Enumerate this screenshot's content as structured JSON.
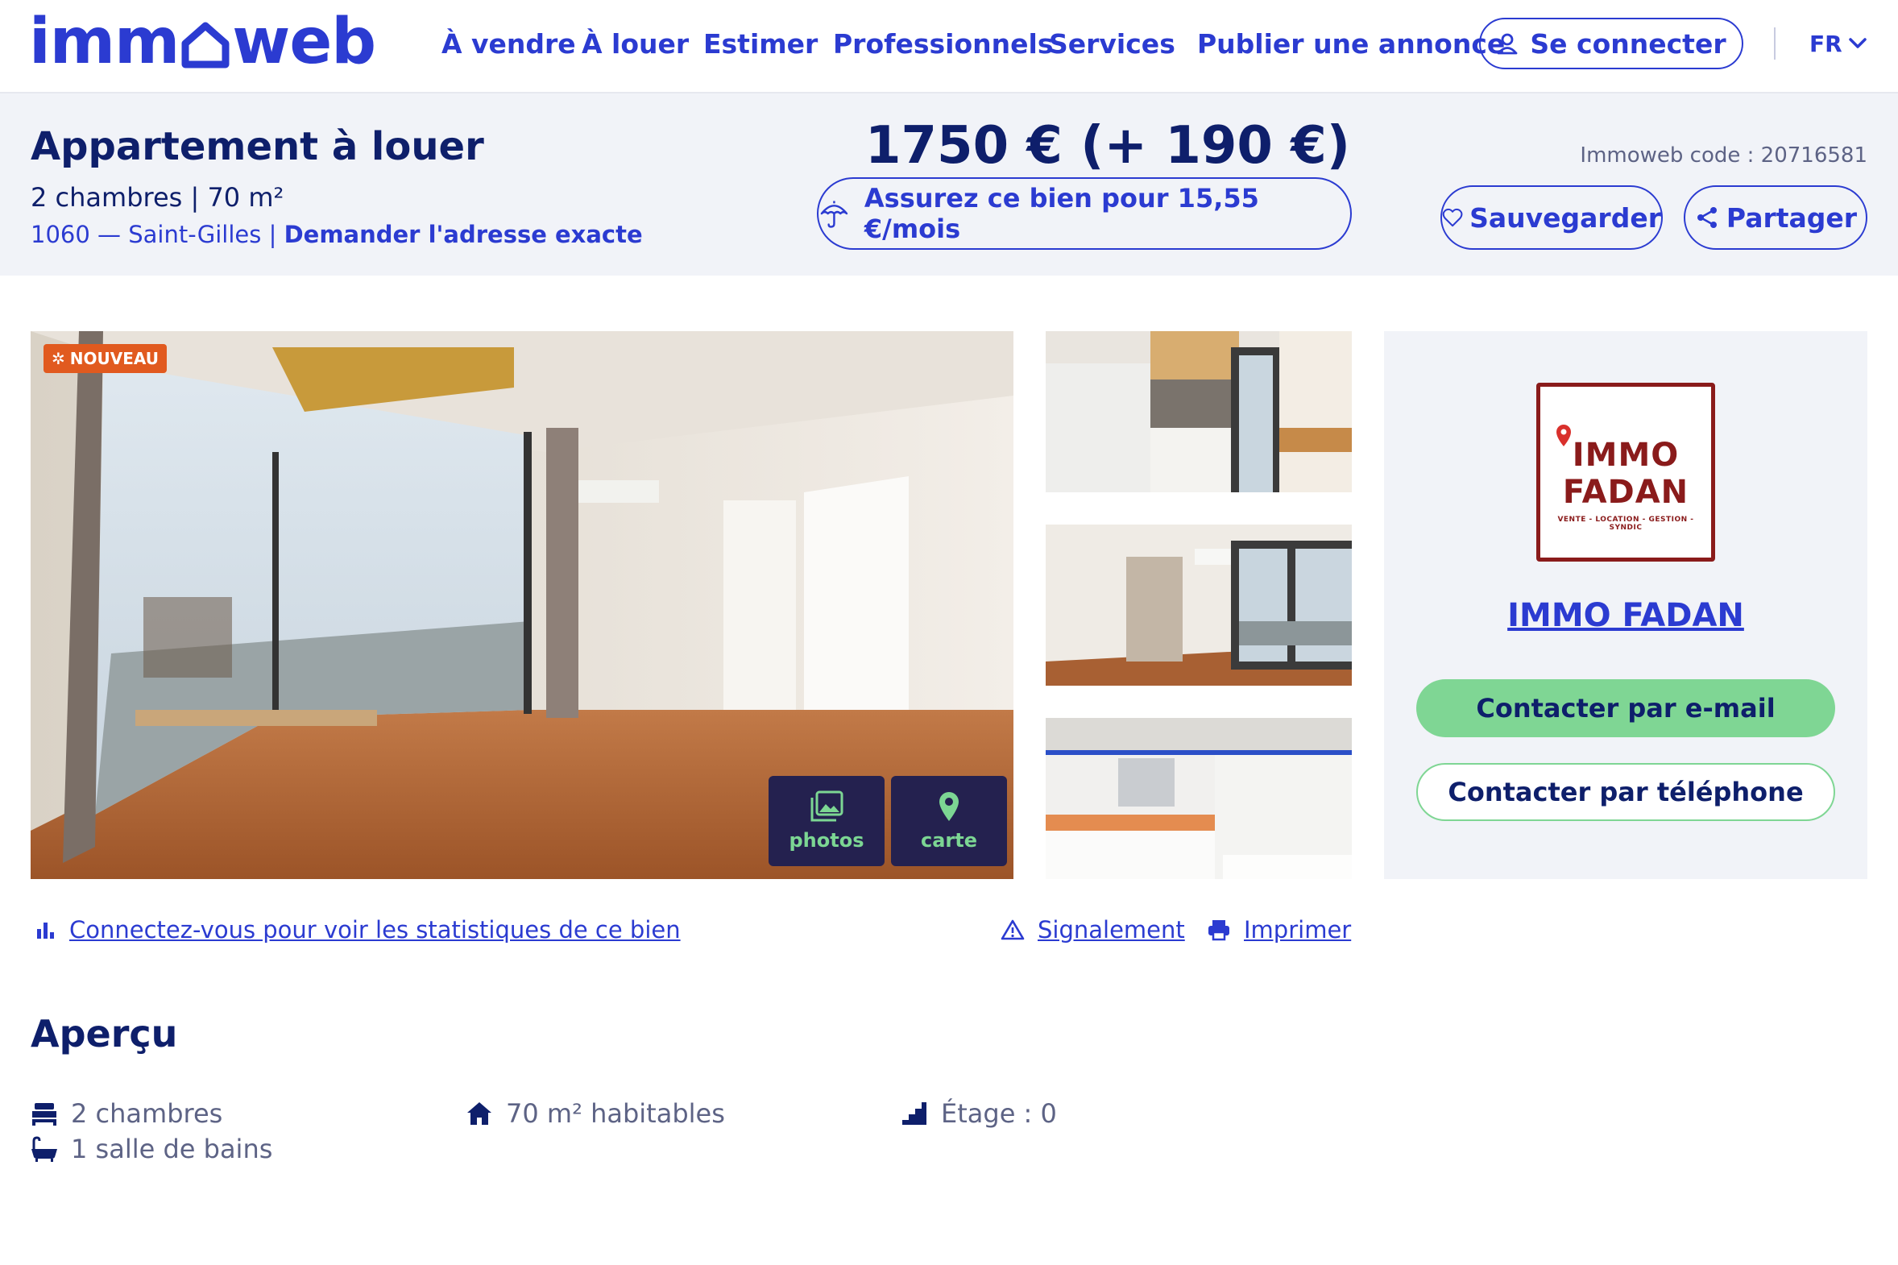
{
  "header": {
    "logo_text_left": "imm",
    "logo_text_right": "web",
    "nav": [
      "À vendre",
      "À louer",
      "Estimer",
      "Professionnels",
      "Services",
      "Publier une annonce"
    ],
    "login_label": "Se connecter",
    "language": "FR"
  },
  "listing": {
    "title": "Appartement à louer",
    "subtitle": "2 chambres | 70 m²",
    "address": "1060 — Saint-Gilles",
    "address_sep": " | ",
    "address_link": "Demander l'adresse exacte",
    "price": "1750 € (+ 190 €)",
    "insure_label": "Assurez ce bien pour 15,55 €/mois",
    "code": "Immoweb code : 20716581",
    "save_label": "Sauvegarder",
    "share_label": "Partager"
  },
  "gallery": {
    "badge": "NOUVEAU",
    "photos_label": "photos",
    "map_label": "carte"
  },
  "agency": {
    "logo_line1": "IMMO",
    "logo_line2": "FADAN",
    "logo_tagline": "VENTE - LOCATION - GESTION - SYNDIC",
    "name": "IMMO FADAN",
    "email_label": "Contacter par e-mail",
    "phone_label": "Contacter par téléphone"
  },
  "links": {
    "stats": "Connectez-vous pour voir les statistiques de ce bien",
    "report": "Signalement",
    "print": "Imprimer"
  },
  "overview": {
    "title": "Aperçu",
    "bedrooms": "2 chambres",
    "bathrooms": "1 salle de bains",
    "surface": "70 m² habitables",
    "floor": "Étage : 0"
  },
  "colors": {
    "brand": "#2b3bd1",
    "navy": "#0e1f6b",
    "green": "#7fd694",
    "band": "#f1f3f8",
    "badge": "#e15a1f"
  }
}
